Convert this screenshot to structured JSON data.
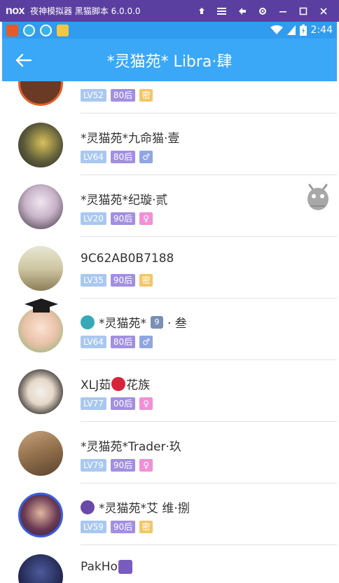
{
  "emulator": {
    "logo": "nox",
    "title": "夜神模拟器  黑猫脚本  6.0.0.0",
    "controls": [
      "pin-icon",
      "menu-icon",
      "restore-window-icon",
      "settings-icon",
      "minimize-icon",
      "maximize-icon",
      "close-icon"
    ]
  },
  "status_bar": {
    "time": "2:44",
    "app_icons": [
      "game-app-icon",
      "browser-app-icon",
      "browser2-app-icon",
      "cube-app-icon"
    ]
  },
  "header": {
    "title": "*灵猫苑* Libra·肆",
    "back_icon": "back-arrow-icon",
    "color": "#3aa7f7"
  },
  "members": [
    {
      "name": "",
      "level": "LV52",
      "age": "80后",
      "gender": "密",
      "gender_type": "secret"
    },
    {
      "name": "*灵猫苑*九命猫·壹",
      "level": "LV64",
      "age": "80后",
      "gender": "♂",
      "gender_type": "male"
    },
    {
      "name": "*灵猫苑*纪璇·贰",
      "level": "LV20",
      "age": "90后",
      "gender": "♀",
      "gender_type": "female"
    },
    {
      "name": "9C62AB0B7188",
      "level": "LV35",
      "age": "90后",
      "gender": "密",
      "gender_type": "secret"
    },
    {
      "name_prefix": "*灵猫苑*",
      "name_badge": "9",
      "name_suffix": "· 叁",
      "level": "LV64",
      "age": "80后",
      "gender": "♂",
      "gender_type": "male"
    },
    {
      "name_prefix": "XLJ茹",
      "name_suffix": "花族",
      "level": "LV77",
      "age": "00后",
      "gender": "♀",
      "gender_type": "female"
    },
    {
      "name": "*灵猫苑*Trader·玖",
      "level": "LV79",
      "age": "90后",
      "gender": "♀",
      "gender_type": "female"
    },
    {
      "name": "*灵猫苑*艾 维·捌",
      "level": "LV59",
      "age": "90后",
      "gender": "密",
      "gender_type": "secret"
    },
    {
      "name": "PakHo",
      "level": "",
      "age": "",
      "gender": "",
      "gender_type": ""
    }
  ]
}
